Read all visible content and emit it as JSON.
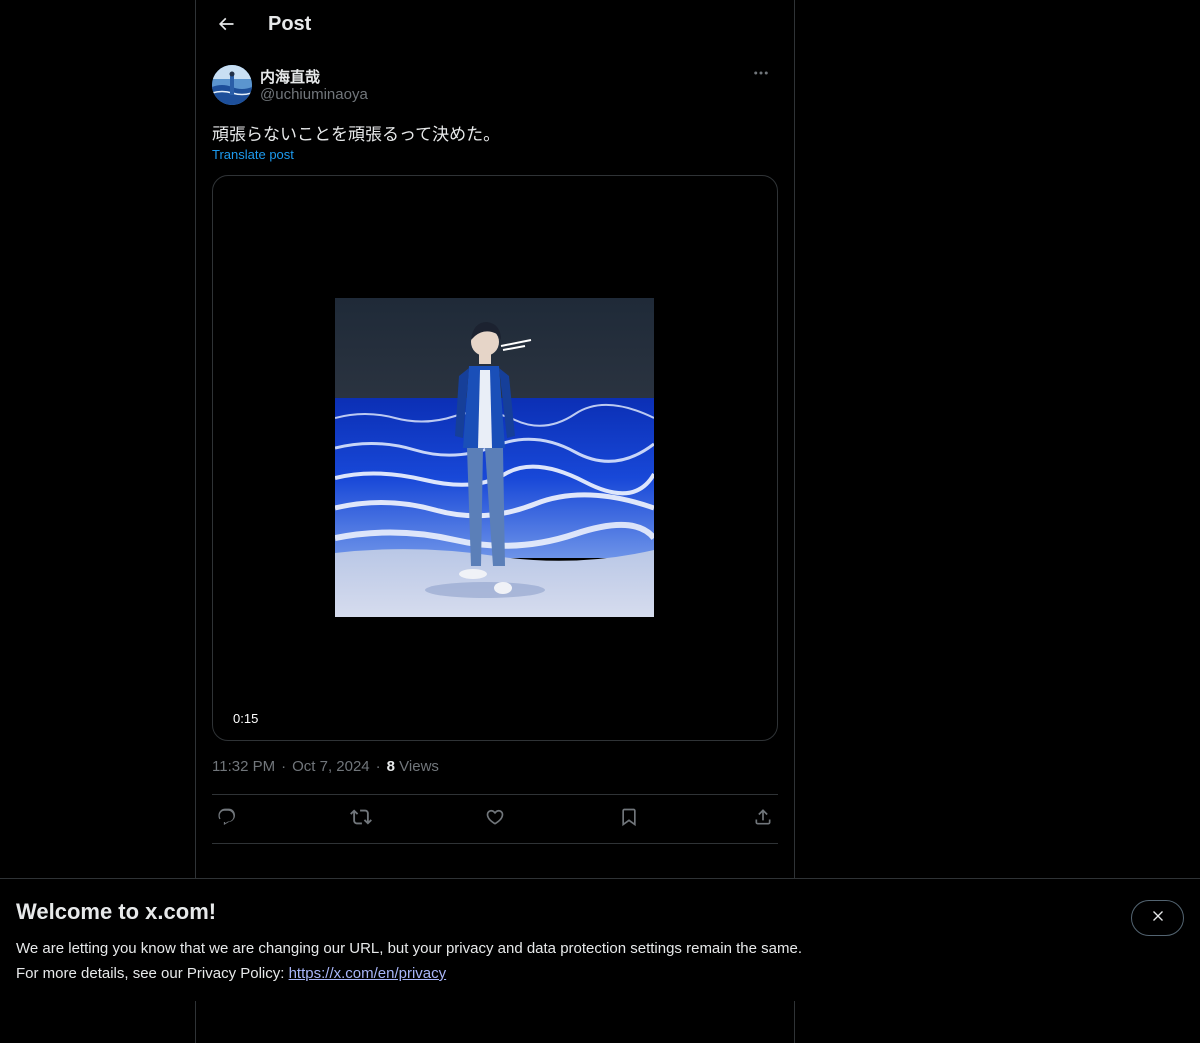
{
  "header": {
    "title": "Post",
    "back_icon": "arrow-left-icon"
  },
  "post": {
    "author": {
      "display_name": "内海直哉",
      "handle": "@uchiuminaoya"
    },
    "text": "頑張らないことを頑張るって決めた。",
    "translate_label": "Translate post",
    "media": {
      "duration": "0:15"
    },
    "time": "11:32 PM",
    "separator": "·",
    "date": "Oct 7, 2024",
    "views_count": "8",
    "views_label": "Views",
    "actions": [
      "reply-icon",
      "repost-icon",
      "like-icon",
      "bookmark-icon",
      "share-icon"
    ]
  },
  "banner": {
    "title": "Welcome to x.com!",
    "line1": "We are letting you know that we are changing our URL, but your privacy and data protection settings remain the same.",
    "line2_prefix": "For more details, see our Privacy Policy: ",
    "link_text": "https://x.com/en/privacy",
    "close_icon": "close-icon"
  },
  "colors": {
    "background": "#000000",
    "text": "#e7e9ea",
    "muted": "#71767b",
    "accent": "#1d9bf0",
    "border": "#2f3336",
    "link": "#a9b6f9"
  }
}
